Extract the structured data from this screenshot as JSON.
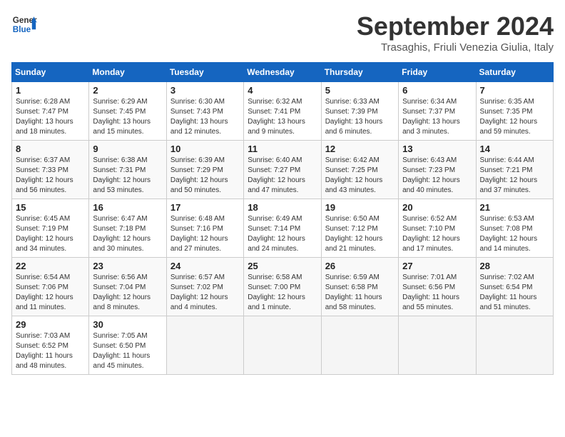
{
  "header": {
    "logo_line1": "General",
    "logo_line2": "Blue",
    "month": "September 2024",
    "location": "Trasaghis, Friuli Venezia Giulia, Italy"
  },
  "weekdays": [
    "Sunday",
    "Monday",
    "Tuesday",
    "Wednesday",
    "Thursday",
    "Friday",
    "Saturday"
  ],
  "weeks": [
    [
      {
        "day": 1,
        "info": "Sunrise: 6:28 AM\nSunset: 7:47 PM\nDaylight: 13 hours and 18 minutes."
      },
      {
        "day": 2,
        "info": "Sunrise: 6:29 AM\nSunset: 7:45 PM\nDaylight: 13 hours and 15 minutes."
      },
      {
        "day": 3,
        "info": "Sunrise: 6:30 AM\nSunset: 7:43 PM\nDaylight: 13 hours and 12 minutes."
      },
      {
        "day": 4,
        "info": "Sunrise: 6:32 AM\nSunset: 7:41 PM\nDaylight: 13 hours and 9 minutes."
      },
      {
        "day": 5,
        "info": "Sunrise: 6:33 AM\nSunset: 7:39 PM\nDaylight: 13 hours and 6 minutes."
      },
      {
        "day": 6,
        "info": "Sunrise: 6:34 AM\nSunset: 7:37 PM\nDaylight: 13 hours and 3 minutes."
      },
      {
        "day": 7,
        "info": "Sunrise: 6:35 AM\nSunset: 7:35 PM\nDaylight: 12 hours and 59 minutes."
      }
    ],
    [
      {
        "day": 8,
        "info": "Sunrise: 6:37 AM\nSunset: 7:33 PM\nDaylight: 12 hours and 56 minutes."
      },
      {
        "day": 9,
        "info": "Sunrise: 6:38 AM\nSunset: 7:31 PM\nDaylight: 12 hours and 53 minutes."
      },
      {
        "day": 10,
        "info": "Sunrise: 6:39 AM\nSunset: 7:29 PM\nDaylight: 12 hours and 50 minutes."
      },
      {
        "day": 11,
        "info": "Sunrise: 6:40 AM\nSunset: 7:27 PM\nDaylight: 12 hours and 47 minutes."
      },
      {
        "day": 12,
        "info": "Sunrise: 6:42 AM\nSunset: 7:25 PM\nDaylight: 12 hours and 43 minutes."
      },
      {
        "day": 13,
        "info": "Sunrise: 6:43 AM\nSunset: 7:23 PM\nDaylight: 12 hours and 40 minutes."
      },
      {
        "day": 14,
        "info": "Sunrise: 6:44 AM\nSunset: 7:21 PM\nDaylight: 12 hours and 37 minutes."
      }
    ],
    [
      {
        "day": 15,
        "info": "Sunrise: 6:45 AM\nSunset: 7:19 PM\nDaylight: 12 hours and 34 minutes."
      },
      {
        "day": 16,
        "info": "Sunrise: 6:47 AM\nSunset: 7:18 PM\nDaylight: 12 hours and 30 minutes."
      },
      {
        "day": 17,
        "info": "Sunrise: 6:48 AM\nSunset: 7:16 PM\nDaylight: 12 hours and 27 minutes."
      },
      {
        "day": 18,
        "info": "Sunrise: 6:49 AM\nSunset: 7:14 PM\nDaylight: 12 hours and 24 minutes."
      },
      {
        "day": 19,
        "info": "Sunrise: 6:50 AM\nSunset: 7:12 PM\nDaylight: 12 hours and 21 minutes."
      },
      {
        "day": 20,
        "info": "Sunrise: 6:52 AM\nSunset: 7:10 PM\nDaylight: 12 hours and 17 minutes."
      },
      {
        "day": 21,
        "info": "Sunrise: 6:53 AM\nSunset: 7:08 PM\nDaylight: 12 hours and 14 minutes."
      }
    ],
    [
      {
        "day": 22,
        "info": "Sunrise: 6:54 AM\nSunset: 7:06 PM\nDaylight: 12 hours and 11 minutes."
      },
      {
        "day": 23,
        "info": "Sunrise: 6:56 AM\nSunset: 7:04 PM\nDaylight: 12 hours and 8 minutes."
      },
      {
        "day": 24,
        "info": "Sunrise: 6:57 AM\nSunset: 7:02 PM\nDaylight: 12 hours and 4 minutes."
      },
      {
        "day": 25,
        "info": "Sunrise: 6:58 AM\nSunset: 7:00 PM\nDaylight: 12 hours and 1 minute."
      },
      {
        "day": 26,
        "info": "Sunrise: 6:59 AM\nSunset: 6:58 PM\nDaylight: 11 hours and 58 minutes."
      },
      {
        "day": 27,
        "info": "Sunrise: 7:01 AM\nSunset: 6:56 PM\nDaylight: 11 hours and 55 minutes."
      },
      {
        "day": 28,
        "info": "Sunrise: 7:02 AM\nSunset: 6:54 PM\nDaylight: 11 hours and 51 minutes."
      }
    ],
    [
      {
        "day": 29,
        "info": "Sunrise: 7:03 AM\nSunset: 6:52 PM\nDaylight: 11 hours and 48 minutes."
      },
      {
        "day": 30,
        "info": "Sunrise: 7:05 AM\nSunset: 6:50 PM\nDaylight: 11 hours and 45 minutes."
      },
      null,
      null,
      null,
      null,
      null
    ]
  ]
}
